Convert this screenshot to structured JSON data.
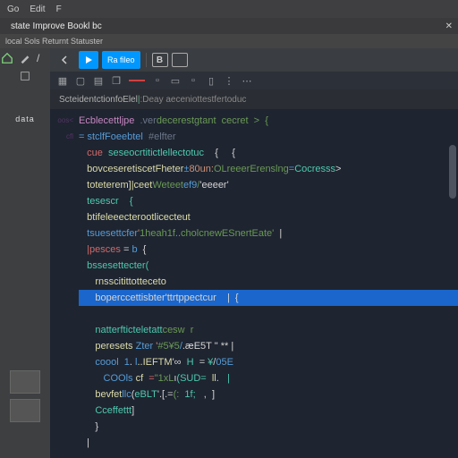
{
  "menubar": {
    "items": [
      "Go",
      "Edit",
      "F"
    ]
  },
  "tabstrip": {
    "title": "state Improve Bookl bc"
  },
  "locbar": {
    "path": "local Sols Returnt Statuster"
  },
  "toolbar": {
    "pen_label": "/",
    "run_label": "Ra fileo"
  },
  "breadcrumb": {
    "fn": "ScteidentctionfoElel",
    "sep": "│",
    "arg": "Deay  aeceniottestfertoduc"
  },
  "sidebar": {
    "label": "data"
  },
  "editor": {
    "lines": [
      {
        "gut": "oos<",
        "ind": 0,
        "frags": [
          [
            "kw",
            "Ecblecettljpe"
          ],
          [
            "wt",
            "  "
          ],
          [
            "dim",
            ".ver"
          ],
          [
            "gr",
            "decerestgtant  cecret  >  {"
          ]
        ]
      },
      {
        "gut": "cfl",
        "ind": 0,
        "frags": [
          [
            "bl",
            "= stclfFoeebtel"
          ],
          [
            "wt",
            "  "
          ],
          [
            "dim",
            "#elfter"
          ]
        ]
      },
      {
        "gut": "",
        "ind": 1,
        "frags": [
          [
            "rd",
            "cue  "
          ],
          [
            "cy",
            "seseocrtitictlellectotuc"
          ],
          [
            "wt",
            "    {     {"
          ]
        ]
      },
      {
        "gut": "",
        "ind": 1,
        "frags": [
          [
            "ye",
            "bovceseretiscetFheter"
          ],
          [
            "bl",
            "±"
          ],
          [
            "or",
            "80un:"
          ],
          [
            "gr",
            "OLreeerErenslng"
          ],
          [
            "bl",
            "="
          ],
          [
            "cy",
            "Cocresss"
          ],
          [
            "wt",
            ">"
          ]
        ]
      },
      {
        "gut": "",
        "ind": 1,
        "frags": [
          [
            "ye",
            "toteterem]|ceet"
          ],
          [
            "gr",
            "Weteet"
          ],
          [
            "bl",
            "ef9"
          ],
          [
            "gr",
            "/"
          ],
          [
            "wt",
            "'eeeer'"
          ]
        ]
      },
      {
        "gut": "",
        "ind": 1,
        "frags": [
          [
            "cy",
            "tesescr    {"
          ],
          [
            "wt",
            ""
          ]
        ]
      },
      {
        "gut": "",
        "ind": 1,
        "frags": [
          [
            "ye",
            "btifeleeecterootlicecteut"
          ],
          [
            "wt",
            ""
          ]
        ]
      },
      {
        "gut": "",
        "ind": 1,
        "frags": [
          [
            "bl",
            "tsuesettcfer"
          ],
          [
            "or",
            "'"
          ],
          [
            "gr",
            "1heah1f"
          ],
          [
            "bl",
            ".."
          ],
          [
            "gr",
            "cholcnewESnertEate'"
          ],
          [
            "wt",
            "  |"
          ]
        ]
      },
      {
        "gut": "",
        "ind": 1,
        "frags": [
          [
            "rd",
            "|pesces"
          ],
          [
            "wt",
            " = "
          ],
          [
            "bl",
            "b"
          ],
          [
            "wt",
            "  {"
          ]
        ]
      },
      {
        "gut": "",
        "ind": 1,
        "frags": [
          [
            "cy",
            "bssesettecter("
          ],
          [
            "wt",
            ""
          ]
        ]
      },
      {
        "gut": "",
        "ind": 2,
        "frags": [
          [
            "ye",
            "rnsscitittotteceto"
          ],
          [
            "wt",
            ""
          ]
        ]
      },
      {
        "gut": "",
        "ind": 2,
        "hl": true,
        "frags": [
          [
            "wt",
            "boperccettisbter'ttrtppectcur"
          ],
          [
            "wt",
            "    |  {"
          ]
        ]
      },
      {
        "gut": "",
        "ind": 2,
        "frags": [
          [
            "wt",
            ""
          ]
        ]
      },
      {
        "gut": "",
        "ind": 2,
        "frags": [
          [
            "cy",
            "natterfticteletatt"
          ],
          [
            "gr",
            "cesw  r"
          ]
        ]
      },
      {
        "gut": "",
        "ind": 2,
        "frags": [
          [
            "ye",
            "peresets "
          ],
          [
            "bl",
            "Zter "
          ],
          [
            "or",
            "'"
          ],
          [
            "gr",
            "#5¥5"
          ],
          [
            "bl",
            "/"
          ],
          [
            "wt",
            ".æE5T \" ** |"
          ]
        ]
      },
      {
        "gut": "",
        "ind": 2,
        "frags": [
          [
            "bl",
            "coool  1"
          ],
          [
            "wt",
            ". "
          ],
          [
            "bl",
            "l"
          ],
          [
            "ye",
            "..IEFTM"
          ],
          [
            "wt",
            "'∞  "
          ],
          [
            "cy",
            "H"
          ],
          [
            "wt",
            "  = "
          ],
          [
            "cy",
            "¥"
          ],
          [
            "wt",
            "/"
          ],
          [
            "bl",
            "05E"
          ]
        ]
      },
      {
        "gut": "",
        "ind": 3,
        "frags": [
          [
            "bl",
            "COOls "
          ],
          [
            "ye",
            "cf"
          ],
          [
            "wt",
            "  "
          ],
          [
            "rd",
            "="
          ],
          [
            "gr",
            "\"1xL"
          ],
          [
            "wt",
            "ı"
          ],
          [
            "cy",
            "(SUD="
          ],
          [
            "wt",
            "  "
          ],
          [
            "ye",
            "ll"
          ],
          [
            "wt",
            "."
          ],
          [
            "cy",
            "   |"
          ]
        ]
      },
      {
        "gut": "",
        "ind": 2,
        "frags": [
          [
            "ye",
            "bevfet"
          ],
          [
            "bl",
            "llc"
          ],
          [
            "wt",
            "("
          ],
          [
            "cy",
            "eBLT"
          ],
          [
            "wt",
            "'.[.="
          ],
          [
            "gr",
            "(:  "
          ],
          [
            "cy",
            "1f;"
          ],
          [
            "wt",
            "   ,  ]"
          ]
        ]
      },
      {
        "gut": "",
        "ind": 2,
        "frags": [
          [
            "cy",
            "Cceffettt"
          ],
          [
            "wt",
            "]"
          ]
        ]
      },
      {
        "gut": "",
        "ind": 2,
        "frags": [
          [
            "wt",
            "}"
          ]
        ]
      },
      {
        "gut": "",
        "ind": 1,
        "frags": [
          [
            "wt",
            "|"
          ]
        ]
      }
    ]
  }
}
